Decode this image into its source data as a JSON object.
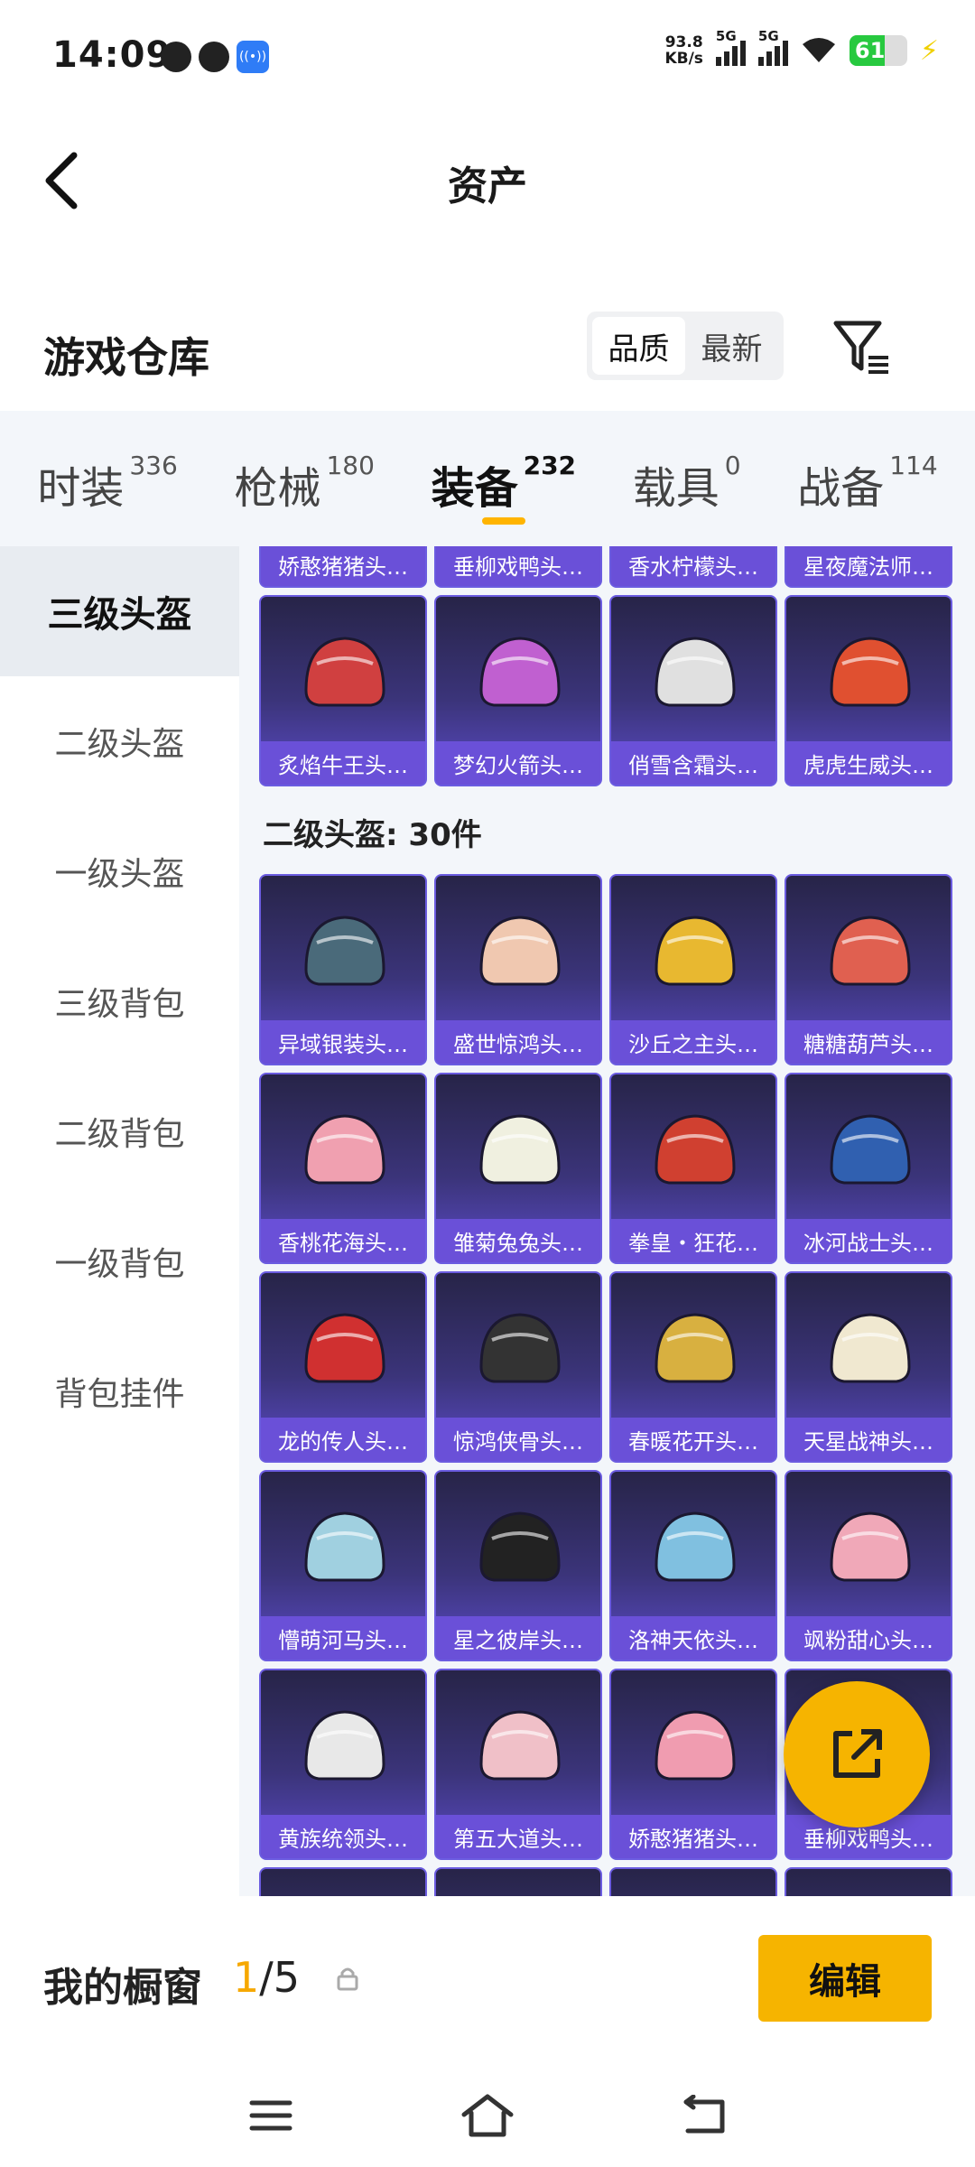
{
  "status_bar": {
    "time": "14:09",
    "net_speed_value": "93.8",
    "net_speed_unit": "KB/s",
    "sim1_label": "5G",
    "sim2_label": "5G",
    "battery": "61"
  },
  "header": {
    "title": "资产"
  },
  "warehouse": {
    "title": "游戏仓库",
    "sort_options": [
      "品质",
      "最新"
    ],
    "sort_active": "品质"
  },
  "category_tabs": [
    {
      "name": "时装",
      "count": "336"
    },
    {
      "name": "枪械",
      "count": "180"
    },
    {
      "name": "装备",
      "count": "232",
      "active": true
    },
    {
      "name": "载具",
      "count": "0"
    },
    {
      "name": "战备",
      "count": "114"
    }
  ],
  "sidebar": {
    "items": [
      "三级头盔",
      "二级头盔",
      "一级头盔",
      "三级背包",
      "二级背包",
      "一级背包",
      "背包挂件"
    ],
    "active": "三级头盔"
  },
  "grid": {
    "top_partial_row": [
      "娇憨猪猪头…",
      "垂柳戏鸭头…",
      "香水柠檬头…",
      "星夜魔法师…"
    ],
    "level3_row": [
      "炙焰牛王头…",
      "梦幻火箭头…",
      "俏雪含霜头…",
      "虎虎生威头…"
    ],
    "section_title": "二级头盔: 30件",
    "level2_rows": [
      [
        "异域银装头…",
        "盛世惊鸿头…",
        "沙丘之主头…",
        "糖糖葫芦头…"
      ],
      [
        "香桃花海头…",
        "雏菊兔兔头…",
        "拳皇・狂花…",
        "冰河战士头…"
      ],
      [
        "龙的传人头…",
        "惊鸿侠骨头…",
        "春暖花开头…",
        "天星战神头…"
      ],
      [
        "懵萌河马头…",
        "星之彼岸头…",
        "洛神天依头…",
        "飒粉甜心头…"
      ],
      [
        "黄族统领头…",
        "第五大道头…",
        "娇憨猪猪头…",
        "垂柳戏鸭头…"
      ]
    ]
  },
  "showcase": {
    "label": "我的橱窗",
    "current": "1",
    "total": "/5",
    "edit_label": "编辑"
  },
  "colors": {
    "accent": "#f6b400",
    "card_label": "#6a50d8",
    "card_bg": "#2d2a56"
  }
}
